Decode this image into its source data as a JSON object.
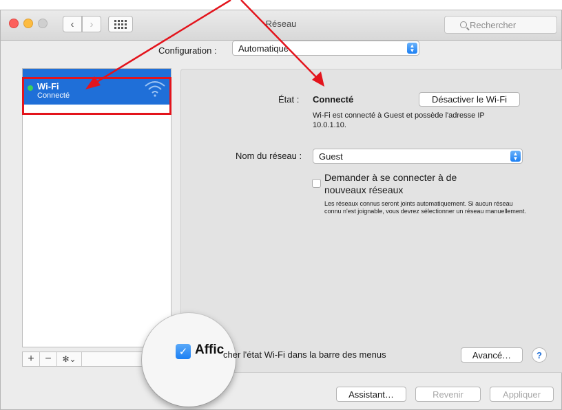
{
  "window": {
    "title": "Réseau"
  },
  "search": {
    "placeholder": "Rechercher"
  },
  "configuration": {
    "label": "Configuration :",
    "value": "Automatique"
  },
  "sidebar": {
    "items": [
      {
        "name": "Wi-Fi",
        "status": "Connecté"
      }
    ],
    "tools": {
      "add": "+",
      "remove": "−",
      "gear": "✻⌄"
    }
  },
  "wifi": {
    "state_label": "État :",
    "state_value": "Connecté",
    "disable_button": "Désactiver le Wi-Fi",
    "description": "Wi-Fi est connecté à Guest et possède l'adresse IP 10.0.1.10.",
    "network_label": "Nom du réseau :",
    "network_value": "Guest",
    "ask_join_label": "Demander à se connecter à de nouveaux réseaux",
    "ask_join_note": "Les réseaux connus seront joints automatiquement. Si aucun réseau connu n'est joignable, vous devrez sélectionner un réseau manuellement.",
    "show_in_menubar_magnified": "Affic",
    "show_in_menubar_label": "cher l'état Wi-Fi dans la barre des menus",
    "advanced_button": "Avancé…",
    "help_button": "?"
  },
  "footer": {
    "assistant": "Assistant…",
    "revert": "Revenir",
    "apply": "Appliquer"
  },
  "colors": {
    "selection": "#1f6fd8",
    "annotation": "#e3141c",
    "connected_dot": "#3bd15a"
  }
}
